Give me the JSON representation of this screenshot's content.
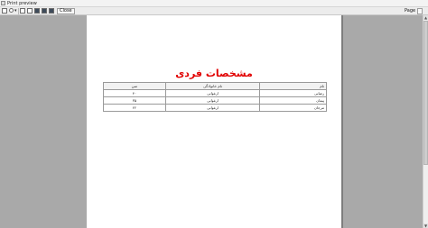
{
  "window": {
    "title": "Print preview"
  },
  "toolbar": {
    "close_label": "Close",
    "page_label": "Page",
    "buttons": [
      {
        "icon": "print-icon"
      },
      {
        "icon": "zoom-icon"
      },
      {
        "icon": "one-page-icon"
      },
      {
        "icon": "two-pages-icon"
      },
      {
        "icon": "three-pages-icon"
      },
      {
        "icon": "four-pages-icon"
      },
      {
        "icon": "six-pages-icon"
      }
    ]
  },
  "report": {
    "title": "مشخصات فردی",
    "columns": [
      "نام",
      "نام خانوادگی",
      "سن"
    ],
    "rows": [
      [
        "رضایی",
        "ارغوانی",
        "۴۰"
      ],
      [
        "پیمان",
        "ارغوانی",
        "۳۵"
      ],
      [
        "مرجان",
        "ارغوانی",
        "۲۲"
      ]
    ]
  },
  "colors": {
    "title": "#e10000",
    "desktop": "#a9a9a9",
    "page": "#ffffff"
  }
}
